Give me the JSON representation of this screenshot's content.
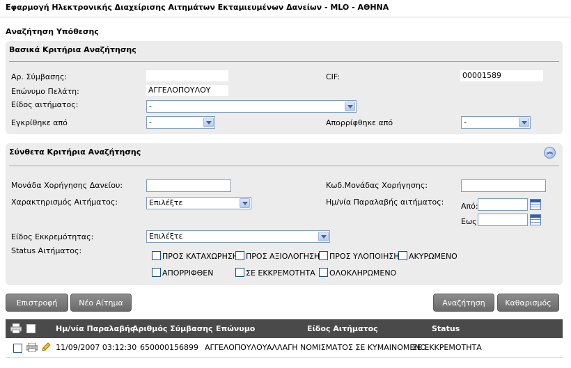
{
  "app": {
    "title": "Εφαρμογή Ηλεκτρονικής Διαχείρισης Αιτημάτων Εκταμιευμένων Δανείων - MLO - ΑΘΗΝΑ",
    "section_title": "Αναζήτηση Υπόθεσης"
  },
  "basic": {
    "title": "Βασικά Κριτήρια Αναζήτησης",
    "contract_label": "Αρ. Σύμβασης:",
    "contract_value": "",
    "cif_label": "CIF:",
    "cif_value": "00001589",
    "surname_label": "Επώνυμο Πελάτη:",
    "surname_value": "ΑΓΓΕΛΟΠΟΥΛΟΥ",
    "request_type_label": "Είδος αιτήματος:",
    "request_type_value": "-",
    "approved_by_label": "Εγκρίθηκε από",
    "approved_by_value": "-",
    "rejected_by_label": "Απορρίφθηκε από",
    "rejected_by_value": "-"
  },
  "advanced": {
    "title": "Σύνθετα Κριτήρια Αναζήτησης",
    "unit_label": "Μονάδα Χορήγησης Δανείου:",
    "unit_value": "",
    "unit_code_label": "Κωδ.Μονάδας Χορήγησης:",
    "unit_code_value": "",
    "characterization_label": "Χαρακτηρισμός Αιτήματος:",
    "characterization_value": "Επιλέξτε",
    "received_date_label": "Ημ/νία Παραλαβής αιτήματος:",
    "from_label": "Από:",
    "from_value": "",
    "to_label": "Εως:",
    "to_value": "",
    "pending_type_label": "Είδος Εκκρεμότητας:",
    "pending_type_value": "Επιλέξτε",
    "status_label": "Status Αιτήματος:",
    "statuses": [
      "ΠΡΟΣ ΚΑΤΑΧΩΡΗΣΗ",
      "ΠΡΟΣ ΑΞΙΟΛΟΓΗΣΗ",
      "ΠΡΟΣ ΥΛΟΠΟΙΗΣΗ",
      "ΑΚΥΡΩΜΕΝΟ",
      "ΑΠΟΡΡΙΦΘΕΝ",
      "ΣΕ ΕΚΚΡΕΜΟΤΗΤΑ",
      "ΟΛΟΚΛΗΡΩΜΕΝΟ"
    ]
  },
  "buttons": {
    "back": "Επιστροφή",
    "new_request": "Νέο Αίτημα",
    "search": "Αναζήτηση",
    "clear": "Καθαρισμός"
  },
  "grid": {
    "headers": {
      "received_date": "Ημ/νία Παραλαβής",
      "contract_no": "Αριθμός Σύμβασης",
      "surname": "Επώνυμο",
      "request_type": "Είδος Αιτήματος",
      "status": "Status"
    },
    "rows": [
      {
        "received_date": "11/09/2007 03:12:30",
        "contract_no": "650000156899",
        "surname": "ΑΓΓΕΛΟΠΟΥΛΟΥ",
        "request_type": "ΑΛΛΑΓΗ ΝΟΜΙΣΜΑΤΟΣ ΣΕ ΚΥΜΑΙΝΟΜΕΝΟ",
        "status": "ΣΕ ΕΚΚΡΕΜΟΤΗΤΑ"
      }
    ]
  },
  "icons": {
    "print_all": "print-all-icon",
    "select_all": "select-all-checkbox",
    "collapse": "collapse-up-icon",
    "calendar": "calendar-icon",
    "print": "print-icon",
    "edit": "pencil-icon"
  }
}
